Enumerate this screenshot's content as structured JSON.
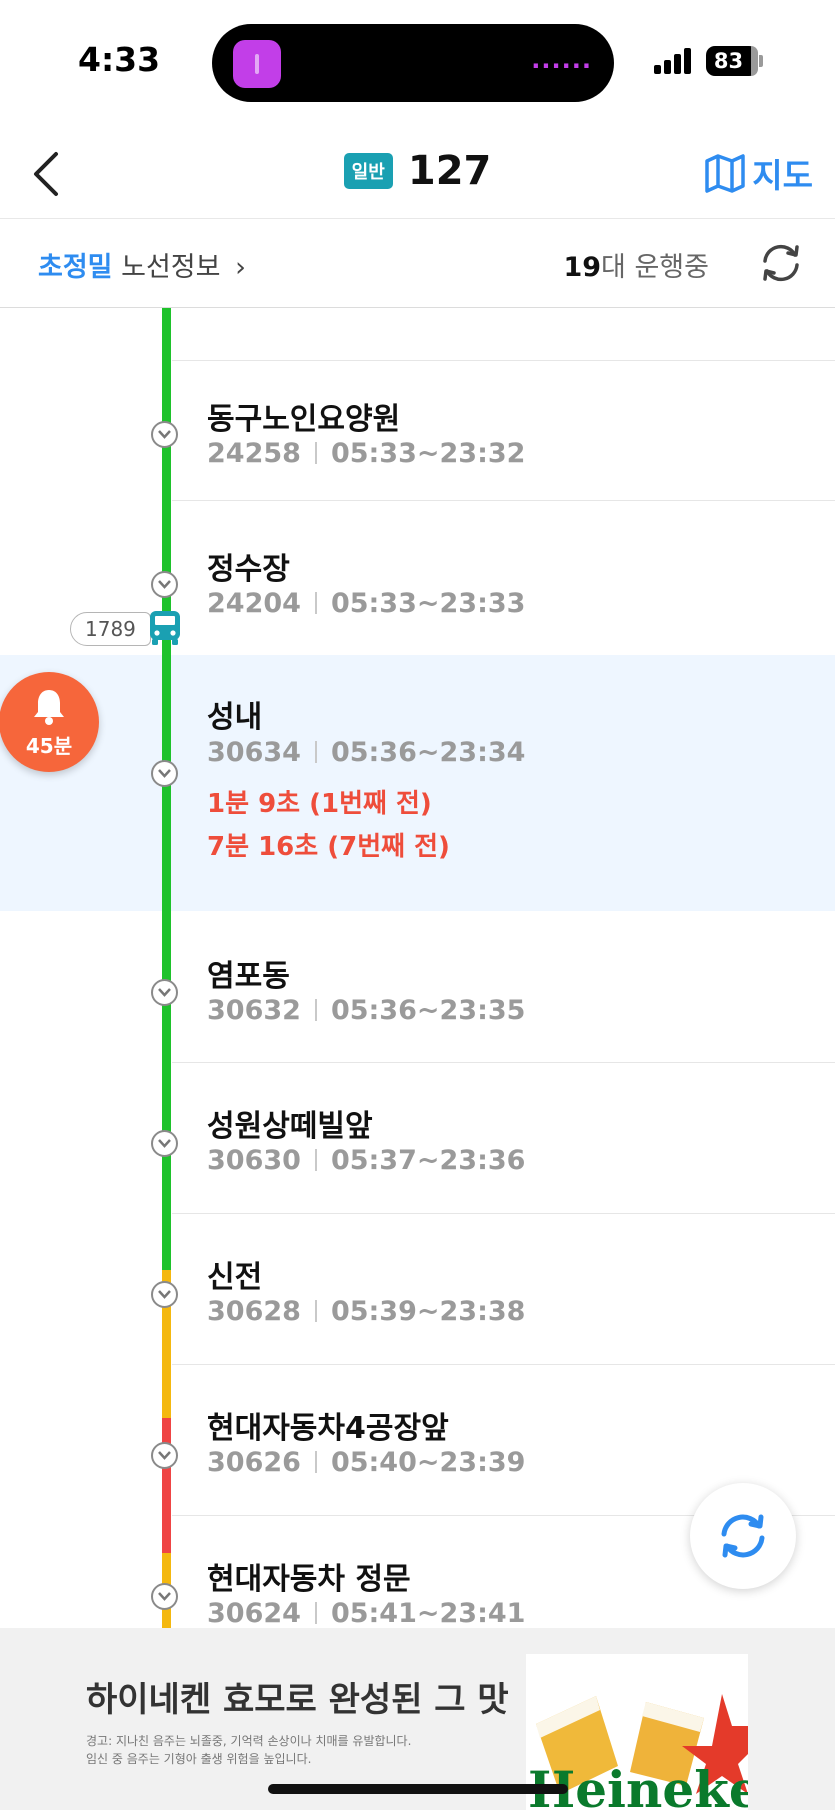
{
  "status_bar": {
    "time": "4:33",
    "battery": "83",
    "island_dots": "......",
    "icons": [
      "island-app-icon",
      "signal-icon",
      "battery-icon"
    ]
  },
  "header": {
    "back_icon": "chevron-left-icon",
    "route_type": "일반",
    "route_number": "127",
    "map_label": "지도",
    "map_icon": "map-icon"
  },
  "info_bar": {
    "area": "초정밀",
    "route_info": "노선정보",
    "chevron": "›",
    "running_count": "19",
    "running_suffix": "대 운행중",
    "refresh_icon": "refresh-icon"
  },
  "colors": {
    "accent_blue": "#2e8cf0",
    "route_green": "#1ec22b",
    "route_yellow": "#f4b80f",
    "route_red": "#ef4444",
    "arrival_red": "#ee4d3b",
    "highlight_bg": "#eef6ff",
    "alarm_orange": "#f6663b",
    "badge_teal": "#1aa0b2"
  },
  "stops": [
    {
      "name": "동구노인요양원",
      "id": "24258",
      "hours": "05:33~23:32"
    },
    {
      "name": "정수장",
      "id": "24204",
      "hours": "05:33~23:33"
    },
    {
      "name": "성내",
      "id": "30634",
      "hours": "05:36~23:34",
      "arrivals": [
        "1분 9초 (1번째 전)",
        "7분 16초 (7번째 전)"
      ]
    },
    {
      "name": "염포동",
      "id": "30632",
      "hours": "05:36~23:35"
    },
    {
      "name": "성원상떼빌앞",
      "id": "30630",
      "hours": "05:37~23:36"
    },
    {
      "name": "신전",
      "id": "30628",
      "hours": "05:39~23:38"
    },
    {
      "name": "현대자동차4공장앞",
      "id": "30626",
      "hours": "05:40~23:39"
    },
    {
      "name": "현대자동차 정문",
      "id": "30624",
      "hours": "05:41~23:41"
    }
  ],
  "bus": {
    "plate": "1789",
    "icon": "bus-icon"
  },
  "alarm": {
    "label": "45분",
    "icon": "bell-icon"
  },
  "float_refresh_icon": "refresh-icon",
  "ad": {
    "headline": "하이네켄 효모로 완성된 그 맛",
    "warning_line1": "경고: 지나친 음주는 뇌졸중, 기억력 손상이나 치매를 유발합니다.",
    "warning_line2": "임신 중 음주는 기형아 출생 위험을 높입니다.",
    "brand": "Heineken"
  }
}
